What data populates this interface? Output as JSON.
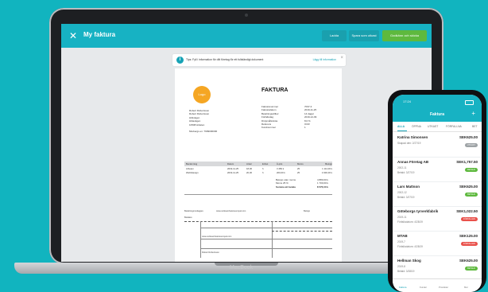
{
  "app": {
    "title": "My faktura",
    "header_buttons": [
      "Ladda",
      "Spara som utkast",
      "Godkänn och skicka"
    ]
  },
  "tip": {
    "text": "Tips: Fyll i information för ditt företag för ett fullständigt dokument",
    "action": "Lägg till information"
  },
  "invoice": {
    "title": "FAKTURA",
    "logo_text": "Logo",
    "sender_lines": [
      "Robert Robertsson",
      "Robert Robertsson",
      "Hittivägen",
      "Hittavägen",
      "10508 Hittelen"
    ],
    "reference": "Mrebergs en: 7999000000",
    "meta": [
      {
        "label": "Fakturanummer",
        "value": "7037-3"
      },
      {
        "label": "Fakturadatum",
        "value": "2019-11-25"
      },
      {
        "label": "Betalningsvillkor",
        "value": "14 dagar"
      },
      {
        "label": "Förfallodag",
        "value": "2019-12-09"
      },
      {
        "label": "Dröjsmålsränta",
        "value": "8,0 %"
      },
      {
        "label": "Referens",
        "value": "OCR"
      },
      {
        "label": "Kundnummer",
        "value": "1"
      }
    ],
    "table_header": [
      "Benämning",
      "Datum",
      "Antal",
      "Enhet",
      "À-pris",
      "Moms",
      "Belopp"
    ],
    "table_rows": [
      [
        "Arbeten",
        "2019-11-25",
        "18,00",
        "h",
        "3 450 k",
        "25",
        "1 114,00 k"
      ],
      [
        "Webbdesign",
        "2019-11-25",
        "20,00",
        "h",
        "200,00 k",
        "25",
        "4 900,00 k"
      ]
    ],
    "totals": [
      {
        "label": "Belopp utan moms",
        "value": "4 880,00 k"
      },
      {
        "label": "Moms 25 %",
        "value": "1 700,00 k"
      },
      {
        "label": "Summa att betala",
        "value": "8 576,00 k"
      }
    ],
    "giro_labels": [
      "Betalningsmottagare",
      "Belopp",
      "Betalare",
      "www.verksamheterexempel.com",
      "Robert Robertsson"
    ]
  },
  "laptop": {
    "brand": "MacBook"
  },
  "phone": {
    "time": "17:24",
    "title": "Faktura",
    "tabs": [
      "ALLA",
      "ÖPPNA",
      "UTKAST",
      "FÖRFALLNA",
      "BET"
    ],
    "items": [
      {
        "name": "Katrina Simonsen",
        "amount": "SEK625.00",
        "date": "Skapad den: 2/27/19",
        "status": "UTKAST",
        "color": "#9ea3a6"
      },
      {
        "name": "Annas Företag AB",
        "amount": "SEK1,757.50",
        "ref": "2002-11",
        "date": "Betald: 3/27/19",
        "status": "BETALD",
        "color": "#5eb93e"
      },
      {
        "name": "Lars Mattson",
        "amount": "SEK625.00",
        "ref": "2002-12",
        "date": "Betald: 3/27/19",
        "status": "BETALD",
        "color": "#5eb93e"
      },
      {
        "name": "Göteborgs tyrverkfabrik",
        "amount": "SEK1,022.50",
        "ref": "2019-11",
        "date": "Förfallodatum: 4/28/19",
        "status": "FÖRFALLEN",
        "color": "#e9514b"
      },
      {
        "name": "MTAB",
        "amount": "SEK125.00",
        "ref": "2019-7",
        "date": "Förfallodatum: 4/28/19",
        "status": "FÖRFALLEN",
        "color": "#e9514b"
      },
      {
        "name": "Hellman Skog",
        "amount": "SEK625.00",
        "ref": "2019-8",
        "date": "Betald: 3/28/19",
        "status": "BETALD",
        "color": "#5eb93e"
      }
    ],
    "nav": [
      "Faktura",
      "Kunder",
      "Produkter",
      "Mer"
    ]
  }
}
